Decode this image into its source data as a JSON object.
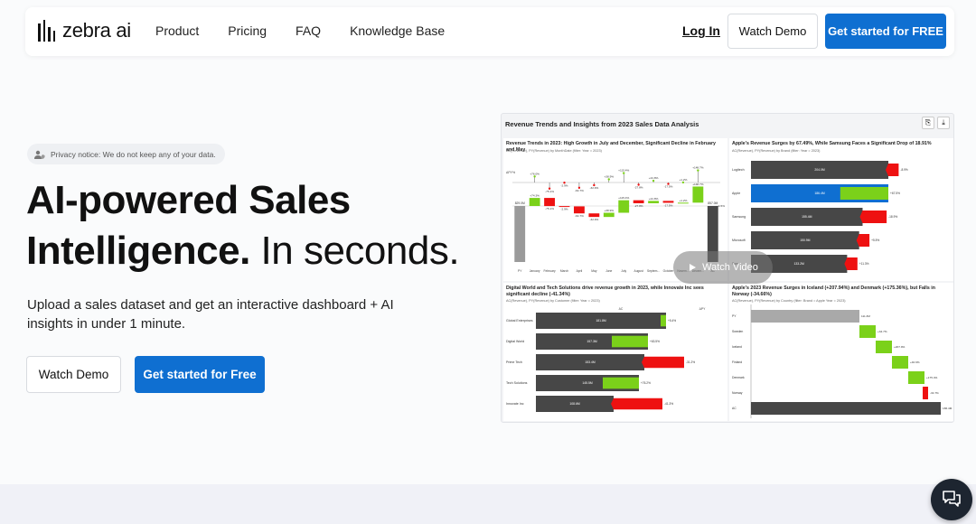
{
  "header": {
    "logo_text": "zebra ai",
    "nav": [
      "Product",
      "Pricing",
      "FAQ",
      "Knowledge Base"
    ],
    "login": "Log In",
    "watch_demo": "Watch Demo",
    "get_started": "Get started for FREE"
  },
  "hero": {
    "privacy_notice": "Privacy notice: We do not keep any of your data.",
    "title_line1": "AI-powered Sales",
    "title_line2_bold": "Intelligence.",
    "title_line2_light": "In seconds.",
    "subtitle": "Upload a sales dataset and get an interactive dashboard + AI insights in under 1 minute.",
    "watch_demo": "Watch Demo",
    "get_started": "Get started for Free"
  },
  "dashboard": {
    "title": "Revenue Trends and Insights from 2023 Sales Data Analysis",
    "video_label": "Watch Video",
    "colors": {
      "increase": "#7bd11a",
      "decrease": "#ee1111",
      "bar": "#474747",
      "prior": "#a9a9a9",
      "highlight": "#0f6fd1"
    },
    "panel1": {
      "title": "Revenue Trends in 2023: High Growth in July and December, Significant Decline in February and May",
      "subtitle": "AC(Revenue), PY(Revenue) by MonthDate (filter: Year = 2023)",
      "months": [
        "PY",
        "January",
        "February",
        "March",
        "April",
        "May",
        "June",
        "July",
        "August",
        "Septem...",
        "October",
        "Novem...",
        "Decem...",
        "AC"
      ],
      "pct_labels": [
        "+76.0%",
        "-75.1%",
        "-2.9%",
        "-64.7%",
        "-32.9%",
        "+38.9%",
        "+115.4%",
        "-27.8%",
        "+21.8%",
        "-17.5%",
        "+1.2%",
        "+148.7%"
      ],
      "var_labels": [
        "+74.3%",
        "-75.1%",
        "-2.9%",
        "-64.7%",
        "-32.9%",
        "+38.9%",
        "+115.4%",
        "-27.8%",
        "+21.8%",
        "-17.5%",
        "+1.2%",
        "+148.7%"
      ],
      "side_labels": [
        "ΔPY%",
        "+1.5%"
      ],
      "py_label": "829.0M",
      "ac_label": "857.0M",
      "variances": [
        74.3,
        -75.1,
        -2.9,
        -64.7,
        -32.9,
        38.9,
        115.4,
        -27.8,
        21.8,
        -17.5,
        1.2,
        148.7
      ]
    },
    "panel2": {
      "title": "Apple's Revenue Surges by 67.49%, While Samsung Faces a Significant Drop of 18.91%",
      "subtitle": "AC(Revenue), PY(Revenue) by Brand (filter: Year = 2023)",
      "rows": [
        {
          "name": "Logitech",
          "value": "204.0M",
          "bar": 0.8,
          "delta": "-8.9%",
          "dtype": "dec",
          "dsize": 0.06
        },
        {
          "name": "Apple",
          "value": "186.4M",
          "bar": 0.8,
          "delta": "+67.5%",
          "dtype": "inc",
          "dsize": 0.28,
          "highlight": true
        },
        {
          "name": "Samsung",
          "value": "155.4M",
          "bar": 0.65,
          "delta": "-18.9%",
          "dtype": "dec",
          "dsize": 0.14
        },
        {
          "name": "Microsoft",
          "value": "150.9M",
          "bar": 0.63,
          "delta": "+5.5%",
          "dtype": "dec",
          "dsize": 0.06
        },
        {
          "name": "Sony",
          "value": "133.2M",
          "bar": 0.56,
          "delta": "+11.3%",
          "dtype": "dec",
          "dsize": 0.06
        }
      ]
    },
    "panel3": {
      "title": "Digital World and Tech Solutions drive revenue growth in 2023, while Innovate Inc sees significant decline (-41.34%)",
      "subtitle": "AC(Revenue), PY(Revenue) by Customer (filter: Year = 2023)",
      "col_labels": [
        "AC",
        "ΔPY"
      ],
      "rows": [
        {
          "name": "Global Enterprises",
          "value": "181.8M",
          "bar": 0.72,
          "delta": "+5.4%",
          "dtype": "inc",
          "dsize": 0.03
        },
        {
          "name": "Digital World",
          "value": "157.3M",
          "bar": 0.62,
          "delta": "+63.5%",
          "dtype": "inc",
          "dsize": 0.2
        },
        {
          "name": "Prime Tech",
          "value": "153.4M",
          "bar": 0.6,
          "delta": "-31.2%",
          "dtype": "dec",
          "dsize": 0.22
        },
        {
          "name": "Tech Solutions",
          "value": "145.5M",
          "bar": 0.57,
          "delta": "+76.2%",
          "dtype": "inc",
          "dsize": 0.2
        },
        {
          "name": "Innovate Inc",
          "value": "108.6M",
          "bar": 0.43,
          "delta": "-41.3%",
          "dtype": "dec",
          "dsize": 0.27
        }
      ]
    },
    "panel4": {
      "title": "Apple's 2023 Revenue Surges in Iceland (+207.94%) and Denmark (+175.36%), but Falls in Norway (-34.66%)",
      "subtitle": "AC(Revenue), PY(Revenue) by Country (filter: Brand = Apple Year = 2023)",
      "rows": [
        {
          "name": "PY",
          "label": "111.3M"
        },
        {
          "name": "Sweden",
          "label": "+34.7%"
        },
        {
          "name": "Iceland",
          "label": "+207.9%"
        },
        {
          "name": "Finland",
          "label": "+40.9%"
        },
        {
          "name": "Denmark",
          "label": "+175.4%"
        },
        {
          "name": "Norway",
          "label": "-34.7%"
        },
        {
          "name": "AC",
          "label": "186.4M"
        }
      ]
    }
  }
}
